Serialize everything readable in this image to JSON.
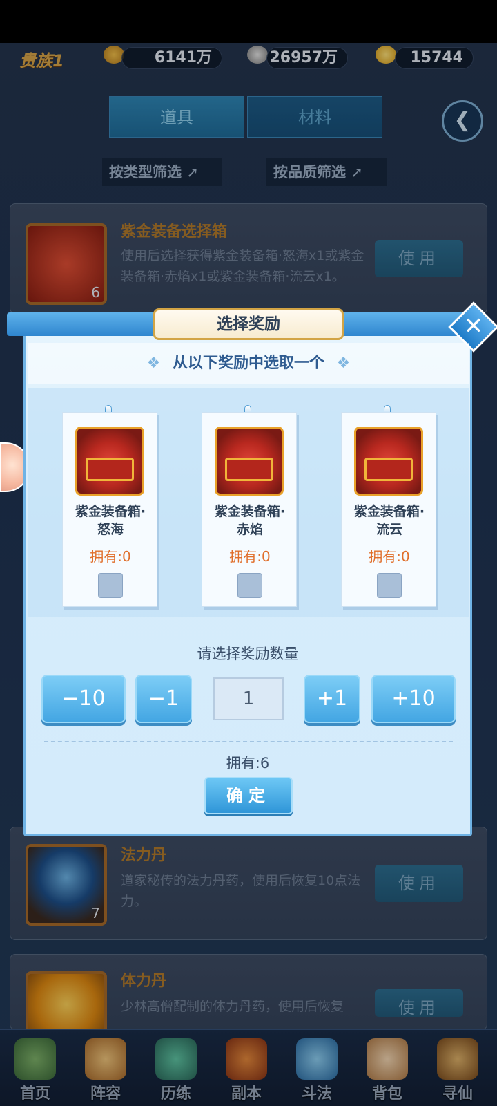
{
  "topbar": {
    "noble_label": "贵族1",
    "coins": "6141万",
    "copper": "26957万",
    "gold": "15744"
  },
  "tabs": [
    {
      "label": "道具",
      "active": true
    },
    {
      "label": "材料",
      "active": false
    }
  ],
  "filters": {
    "by_type": "按类型筛选",
    "by_quality": "按品质筛选"
  },
  "items": [
    {
      "name": "紫金装备选择箱",
      "desc": "使用后选择获得紫金装备箱·怒海x1或紫金装备箱·赤焰x1或紫金装备箱·流云x1。",
      "count": "6",
      "use_label": "使用"
    },
    {
      "name": "法力丹",
      "desc": "道家秘传的法力丹药，使用后恢复10点法力。",
      "count": "7",
      "use_label": "使用"
    },
    {
      "name": "体力丹",
      "desc": "少林高僧配制的体力丹药，使用后恢复",
      "count": "",
      "use_label": "使用"
    }
  ],
  "modal": {
    "title": "选择奖励",
    "subtitle": "从以下奖励中选取一个",
    "rewards": [
      {
        "name_line1": "紫金装备箱·",
        "name_line2": "怒海",
        "owned": "拥有:0"
      },
      {
        "name_line1": "紫金装备箱·",
        "name_line2": "赤焰",
        "owned": "拥有:0"
      },
      {
        "name_line1": "紫金装备箱·",
        "name_line2": "流云",
        "owned": "拥有:0"
      }
    ],
    "qty_label": "请选择奖励数量",
    "qty_buttons": {
      "minus10": "−10",
      "minus1": "−1",
      "plus1": "+1",
      "plus10": "+10"
    },
    "qty_value": "1",
    "owned_total": "拥有:6",
    "confirm_label": "确定"
  },
  "nav": [
    {
      "label": "首页",
      "icon": "home-icon"
    },
    {
      "label": "阵容",
      "icon": "lineup-icon"
    },
    {
      "label": "历练",
      "icon": "training-icon"
    },
    {
      "label": "副本",
      "icon": "dungeon-icon"
    },
    {
      "label": "斗法",
      "icon": "battle-icon"
    },
    {
      "label": "背包",
      "icon": "bag-icon"
    },
    {
      "label": "寻仙",
      "icon": "seek-icon"
    }
  ]
}
